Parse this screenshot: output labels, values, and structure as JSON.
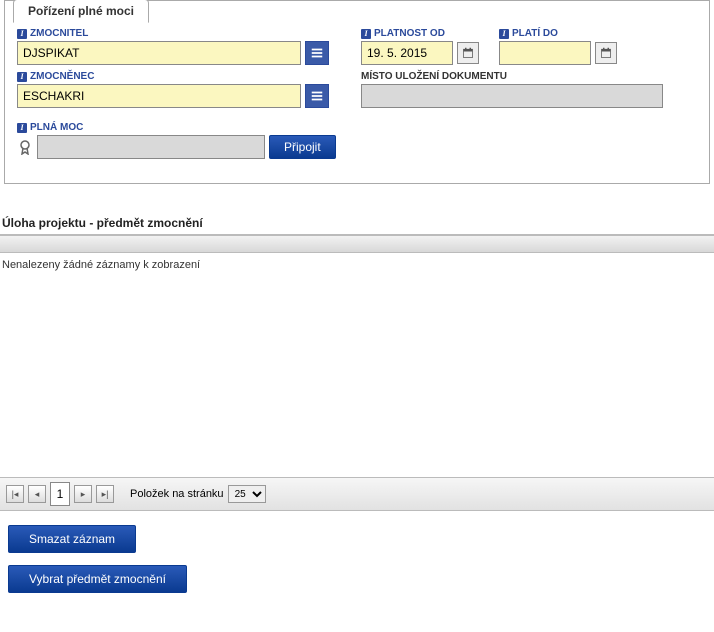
{
  "panel": {
    "title": "Pořízení plné moci"
  },
  "fields": {
    "zmocnitel": {
      "label": "ZMOCNITEL",
      "value": "DJSPIKAT"
    },
    "zmocnenec": {
      "label": "ZMOCNĚNEC",
      "value": "ESCHAKRI"
    },
    "plnaMoc": {
      "label": "PLNÁ MOC",
      "value": ""
    },
    "platnostOd": {
      "label": "PLATNOST OD",
      "value": "19. 5. 2015"
    },
    "platiDo": {
      "label": "PLATÍ DO",
      "value": ""
    },
    "mistoUlozeni": {
      "label": "MÍSTO ULOŽENÍ DOKUMENTU",
      "value": ""
    },
    "pripojitBtn": "Připojit"
  },
  "section": {
    "title": "Úloha projektu - předmět zmocnění"
  },
  "grid": {
    "empty": "Nenalezeny žádné záznamy k zobrazení"
  },
  "pager": {
    "page": "1",
    "itemsLabel": "Položek na stránku",
    "pageSize": "25"
  },
  "actions": {
    "delete": "Smazat záznam",
    "select": "Vybrat předmět zmocnění"
  }
}
